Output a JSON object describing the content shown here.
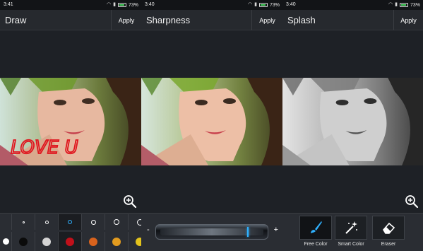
{
  "panels": [
    {
      "status": {
        "time": "3:41",
        "battery": "73%"
      },
      "title": "Draw",
      "apply": "Apply",
      "scribble": "LOVE U",
      "brush_sizes": [
        "",
        "",
        "",
        "",
        "",
        ""
      ],
      "colors": [
        "#ffffff",
        "#0b0b0b",
        "#d4d4d4",
        "#c1101a",
        "#d9631d",
        "#e29b1f",
        "#e3c31c"
      ]
    },
    {
      "status": {
        "time": "3:40",
        "battery": "73%"
      },
      "title": "Sharpness",
      "apply": "Apply",
      "slider": {
        "minus": "-",
        "plus": "+",
        "level": 0.85
      }
    },
    {
      "status": {
        "time": "3:40",
        "battery": "73%"
      },
      "title": "Splash",
      "apply": "Apply",
      "tools": [
        {
          "label": "Free Color",
          "icon": "brush-icon",
          "selected": true
        },
        {
          "label": "Smart Color",
          "icon": "magic-wand-icon",
          "selected": false
        },
        {
          "label": "Eraser",
          "icon": "eraser-icon",
          "selected": false
        }
      ]
    }
  ]
}
